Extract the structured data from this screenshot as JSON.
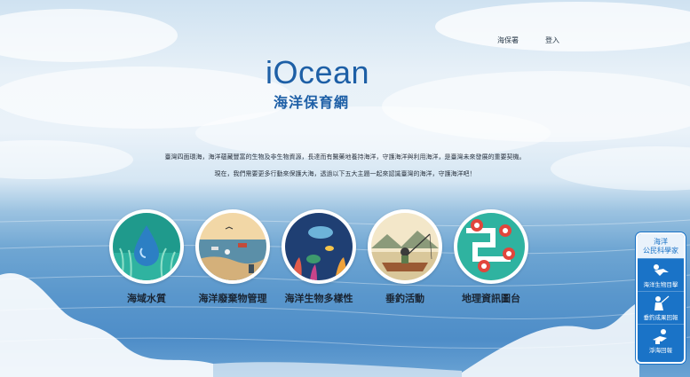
{
  "nav": {
    "links": [
      "海保署",
      "登入"
    ]
  },
  "logo": {
    "en": "iOcean",
    "zh": "海洋保育網"
  },
  "intro": {
    "line1": "臺灣四面環海，海洋蘊藏豐富的生物及非生物資源，長達而有醫藥地養持海洋，守護海洋與利用海洋，是臺灣未來發展的重要契機。",
    "line2": "現在，我們需要更多行動來保護大海，透過以下五大主題一起來認識臺灣的海洋，守護海洋吧！"
  },
  "topics": [
    {
      "label": "海域水質",
      "icon": "water-drop-icon"
    },
    {
      "label": "海洋廢棄物管理",
      "icon": "marine-debris-icon"
    },
    {
      "label": "海洋生物多樣性",
      "icon": "marine-biodiversity-icon"
    },
    {
      "label": "垂釣活動",
      "icon": "fishing-icon"
    },
    {
      "label": "地理資訊圖台",
      "icon": "map-pin-icon"
    }
  ],
  "sidepanel": {
    "title_line1": "海洋",
    "title_line2": "公民科學家",
    "items": [
      {
        "label": "海洋生物目擊",
        "icon": "diver-icon"
      },
      {
        "label": "垂釣成果回報",
        "icon": "angler-icon"
      },
      {
        "label": "淨海回報",
        "icon": "cleanup-diver-icon"
      }
    ]
  },
  "colors": {
    "brand": "#1d5fa6",
    "panel": "#1a73c7"
  }
}
